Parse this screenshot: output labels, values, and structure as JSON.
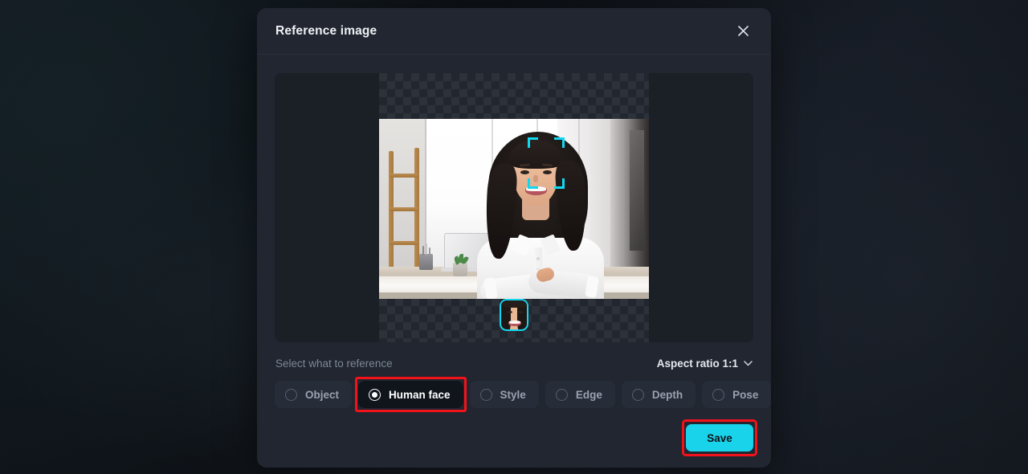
{
  "dialog": {
    "title": "Reference image",
    "close_icon": "close-icon"
  },
  "preview": {
    "alt": "Smiling woman with crossed arms at a desk in a bright office",
    "transparency": "checkerboard",
    "face_detection_label": "face-bracket",
    "face_thumbnail_label": "detected-face-crop"
  },
  "controls": {
    "section_label": "Select what to reference",
    "aspect_ratio_label": "Aspect ratio 1:1",
    "aspect_ratio_icon": "chevron-down-icon",
    "options": [
      {
        "id": "object",
        "label": "Object",
        "selected": false
      },
      {
        "id": "human-face",
        "label": "Human face",
        "selected": true
      },
      {
        "id": "style",
        "label": "Style",
        "selected": false
      },
      {
        "id": "edge",
        "label": "Edge",
        "selected": false
      },
      {
        "id": "depth",
        "label": "Depth",
        "selected": false
      },
      {
        "id": "pose",
        "label": "Pose",
        "selected": false
      }
    ]
  },
  "footer": {
    "save_label": "Save"
  },
  "colors": {
    "accent": "#19d3eb",
    "highlight": "#f4121a",
    "dialog_bg": "#212630",
    "stage_bg": "#1b1f26",
    "bracket": "#12d7f0"
  }
}
